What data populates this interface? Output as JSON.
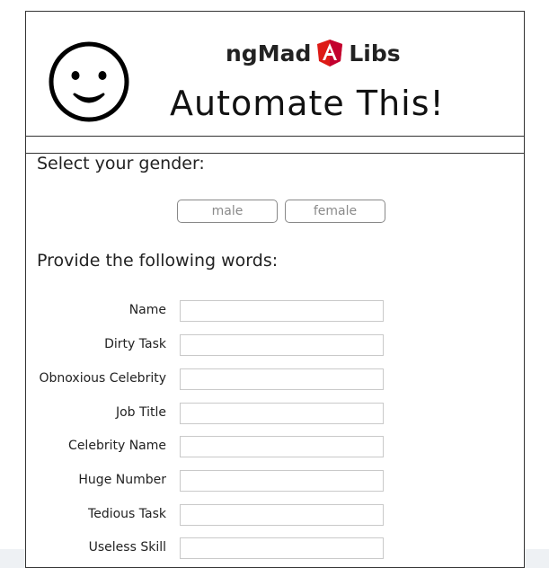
{
  "header": {
    "brand_left": "ngMad",
    "brand_right": "Libs",
    "title": "Automate This!"
  },
  "gender": {
    "heading": "Select your gender:",
    "options": [
      "male",
      "female"
    ]
  },
  "words": {
    "heading": "Provide the following words:",
    "fields": [
      {
        "label": "Name",
        "value": ""
      },
      {
        "label": "Dirty Task",
        "value": ""
      },
      {
        "label": "Obnoxious Celebrity",
        "value": ""
      },
      {
        "label": "Job Title",
        "value": ""
      },
      {
        "label": "Celebrity Name",
        "value": ""
      },
      {
        "label": "Huge Number",
        "value": ""
      },
      {
        "label": "Tedious Task",
        "value": ""
      },
      {
        "label": "Useless Skill",
        "value": ""
      }
    ]
  },
  "icons": {
    "logo": "angular-shield-icon",
    "avatar": "smiley-face-icon"
  },
  "colors": {
    "angular_red": "#dd1b16",
    "border": "#333333",
    "input_border": "#c9c9c9"
  }
}
